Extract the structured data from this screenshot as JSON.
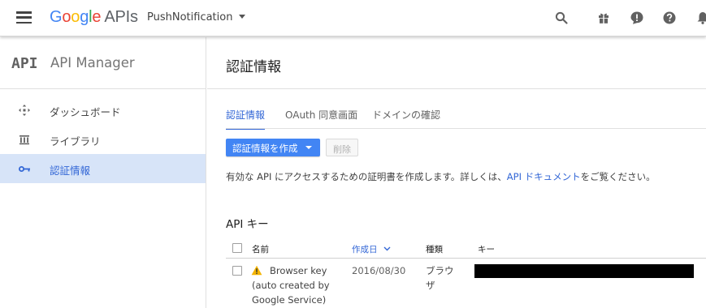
{
  "topbar": {
    "logo": {
      "g1": "G",
      "g2": "o",
      "g3": "o",
      "g4": "g",
      "g5": "l",
      "g6": "e",
      "apis": "APIs"
    },
    "project": "PushNotification",
    "icons": [
      "search-icon",
      "gift-icon",
      "notification-alert-icon",
      "help-icon",
      "bell-icon"
    ]
  },
  "sidebar": {
    "brand_mark": "API",
    "title": "API Manager",
    "items": [
      {
        "label": "ダッシュボード",
        "icon": "dashboard-icon"
      },
      {
        "label": "ライブラリ",
        "icon": "library-icon"
      },
      {
        "label": "認証情報",
        "icon": "key-icon",
        "active": true
      }
    ]
  },
  "main": {
    "title": "認証情報",
    "tabs": [
      {
        "label": "認証情報",
        "active": true
      },
      {
        "label": "OAuth 同意画面"
      },
      {
        "label": "ドメインの確認"
      }
    ],
    "create_button": "認証情報を作成",
    "delete_button": "削除",
    "description_prefix": "有効な API にアクセスするための証明書を作成します。詳しくは、",
    "description_link": "API ドキュメント",
    "description_suffix": "をご覧ください。",
    "section_title": "API キー",
    "table": {
      "headers": {
        "name": "名前",
        "created": "作成日",
        "type": "種類",
        "key": "キー"
      },
      "rows": [
        {
          "name_line1": "Browser key",
          "name_line2": "(auto created by",
          "name_line3": "Google Service)",
          "created": "2016/08/30",
          "type_line1": "ブラウ",
          "type_line2": "ザ",
          "warning": true
        }
      ]
    }
  },
  "colors": {
    "accent": "#4285f4",
    "link": "#3367d6",
    "active_bg": "#d7e4f8",
    "warning": "#f4b400"
  }
}
